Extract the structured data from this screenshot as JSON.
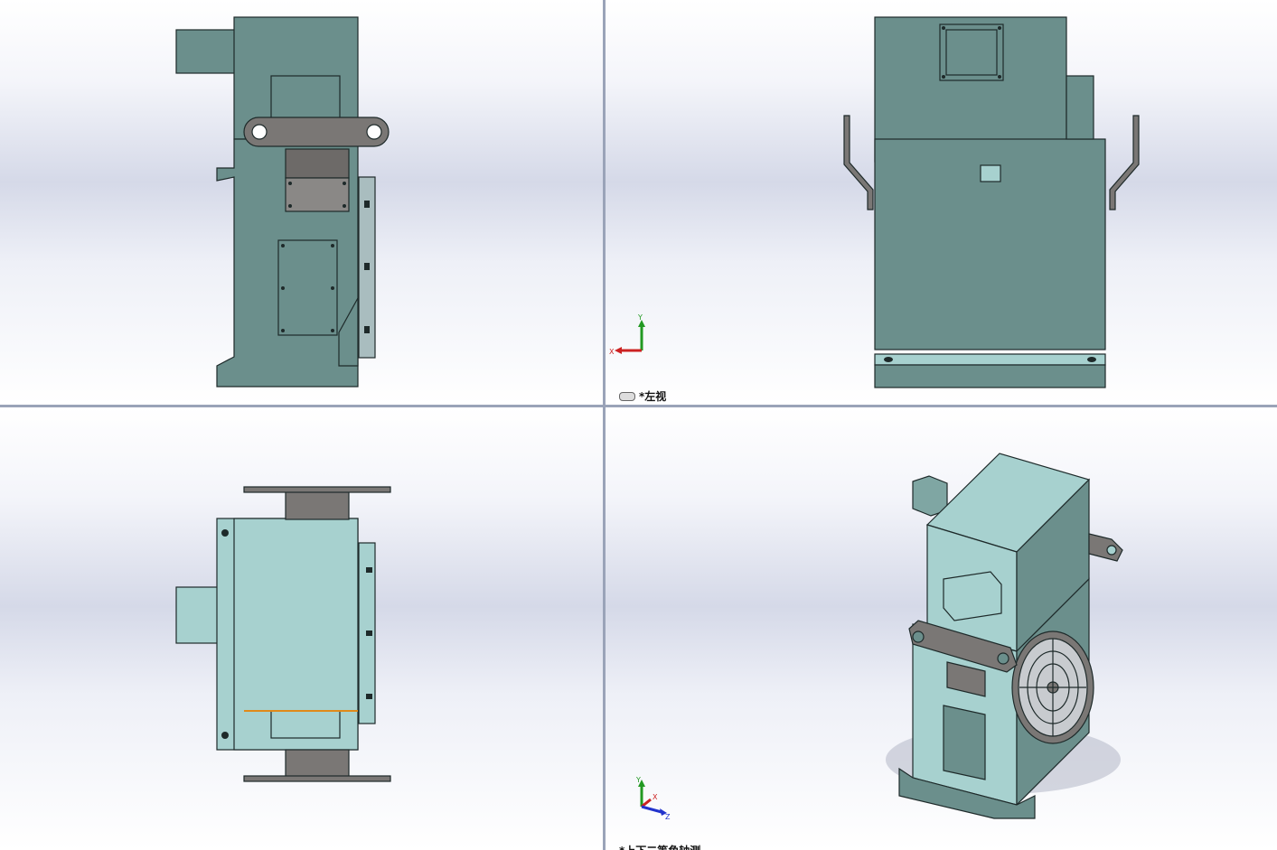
{
  "window": {
    "viewports": [
      {
        "id": "top-left",
        "view_name": ""
      },
      {
        "id": "top-right",
        "view_name": "*左视"
      },
      {
        "id": "bottom-left",
        "view_name": ""
      },
      {
        "id": "bottom-right",
        "view_name": "*上下二等角轴测"
      }
    ]
  },
  "triad": {
    "x_label": "X",
    "y_label": "Y",
    "z_label": "Z"
  },
  "colors": {
    "body": "#6b8f8c",
    "body_light": "#a7d1cf",
    "steel": "#7a7775",
    "x_axis": "#cc2222",
    "y_axis": "#229922",
    "z_axis": "#2233cc",
    "edge": "#1e2a2a"
  }
}
